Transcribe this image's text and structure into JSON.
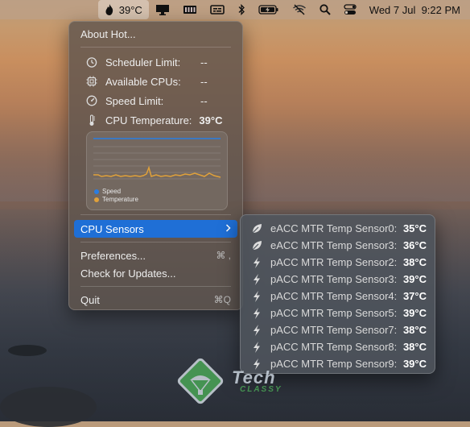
{
  "menubar": {
    "app_temp": "39°C",
    "clock": "Wed 7 Jul  9:22 PM",
    "icons": [
      "flame-icon",
      "display-icon",
      "memory-icon",
      "caption-icon",
      "bluetooth-icon",
      "battery-icon",
      "wifi-off-icon",
      "search-icon",
      "control-center-icon"
    ]
  },
  "menu": {
    "about": "About Hot...",
    "stats": [
      {
        "icon": "stopwatch-icon",
        "label": "Scheduler Limit:",
        "value": "--"
      },
      {
        "icon": "cpu-chip-icon",
        "label": "Available CPUs:",
        "value": "--"
      },
      {
        "icon": "speedometer-icon",
        "label": "Speed Limit:",
        "value": "--"
      },
      {
        "icon": "thermometer-icon",
        "label": "CPU Temperature:",
        "value": "39°C"
      }
    ],
    "graph": {
      "legend_speed": "Speed",
      "legend_temperature": "Temperature",
      "speed_color": "#2a7de1",
      "temperature_color": "#e0a13a"
    },
    "cpu_sensors": "CPU Sensors",
    "preferences": "Preferences...",
    "preferences_shortcut": "⌘ ,",
    "check_updates": "Check for Updates...",
    "quit": "Quit",
    "quit_shortcut": "⌘Q"
  },
  "submenu": {
    "sensors": [
      {
        "icon": "leaf-icon",
        "name": "eACC MTR Temp Sensor0:",
        "temp": "35°C"
      },
      {
        "icon": "leaf-icon",
        "name": "eACC MTR Temp Sensor3:",
        "temp": "36°C"
      },
      {
        "icon": "bolt-icon",
        "name": "pACC MTR Temp Sensor2:",
        "temp": "38°C"
      },
      {
        "icon": "bolt-icon",
        "name": "pACC MTR Temp Sensor3:",
        "temp": "39°C"
      },
      {
        "icon": "bolt-icon",
        "name": "pACC MTR Temp Sensor4:",
        "temp": "37°C"
      },
      {
        "icon": "bolt-icon",
        "name": "pACC MTR Temp Sensor5:",
        "temp": "39°C"
      },
      {
        "icon": "bolt-icon",
        "name": "pACC MTR Temp Sensor7:",
        "temp": "38°C"
      },
      {
        "icon": "bolt-icon",
        "name": "pACC MTR Temp Sensor8:",
        "temp": "38°C"
      },
      {
        "icon": "bolt-icon",
        "name": "pACC MTR Temp Sensor9:",
        "temp": "39°C"
      }
    ]
  },
  "watermark": {
    "line1": "Tech",
    "line2": "CLASSY"
  }
}
